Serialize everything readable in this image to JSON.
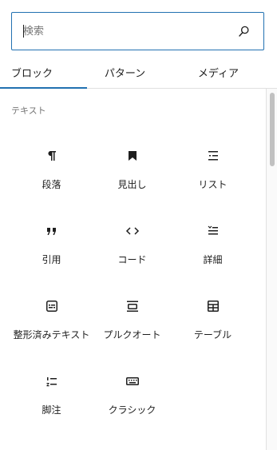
{
  "search": {
    "placeholder": "検索",
    "value": ""
  },
  "tabs": [
    {
      "label": "ブロック",
      "active": true
    },
    {
      "label": "パターン",
      "active": false
    },
    {
      "label": "メディア",
      "active": false
    }
  ],
  "category": {
    "label": "テキスト"
  },
  "blocks": [
    {
      "label": "段落",
      "icon": "paragraph-icon"
    },
    {
      "label": "見出し",
      "icon": "bookmark-heading-icon"
    },
    {
      "label": "リスト",
      "icon": "list-icon"
    },
    {
      "label": "引用",
      "icon": "quote-icon"
    },
    {
      "label": "コード",
      "icon": "code-icon"
    },
    {
      "label": "詳細",
      "icon": "details-icon"
    },
    {
      "label": "整形済みテキスト",
      "icon": "preformatted-icon"
    },
    {
      "label": "プルクオート",
      "icon": "pullquote-icon"
    },
    {
      "label": "テーブル",
      "icon": "table-icon"
    },
    {
      "label": "脚注",
      "icon": "footnotes-icon"
    },
    {
      "label": "クラシック",
      "icon": "keyboard-icon"
    }
  ],
  "colors": {
    "accent": "#2271b1",
    "text": "#1e1e1e",
    "muted": "#757575",
    "border": "#e0e0e0"
  }
}
